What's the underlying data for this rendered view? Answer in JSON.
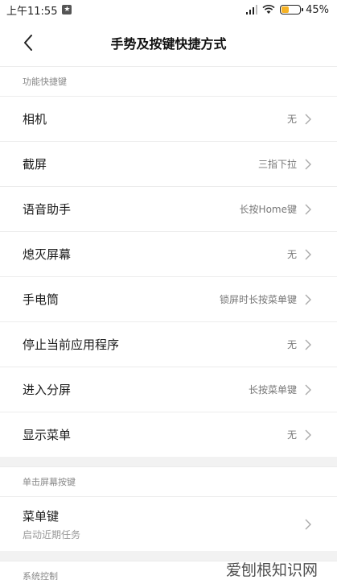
{
  "status_bar": {
    "time": "上午11:55",
    "battery_percent_label": "45%",
    "battery_level": 0.45,
    "battery_color": "#f5b225"
  },
  "header": {
    "title": "手势及按键快捷方式",
    "back_icon": "chevron-left-icon"
  },
  "sections": [
    {
      "header": "功能快捷键",
      "items": [
        {
          "label": "相机",
          "value": "无"
        },
        {
          "label": "截屏",
          "value": "三指下拉"
        },
        {
          "label": "语音助手",
          "value": "长按Home键"
        },
        {
          "label": "熄灭屏幕",
          "value": "无"
        },
        {
          "label": "手电筒",
          "value": "锁屏时长按菜单键"
        },
        {
          "label": "停止当前应用程序",
          "value": "无"
        },
        {
          "label": "进入分屏",
          "value": "长按菜单键"
        },
        {
          "label": "显示菜单",
          "value": "无"
        }
      ]
    },
    {
      "header": "单击屏幕按键",
      "items": [
        {
          "label": "菜单键",
          "subtitle": "启动近期任务"
        }
      ]
    },
    {
      "header": "系统控制"
    }
  ],
  "watermark": "爱刨根知识网"
}
